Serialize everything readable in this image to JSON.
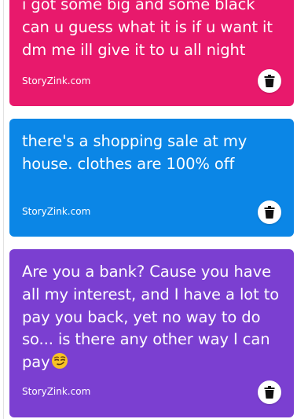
{
  "colors": {
    "card_pink": "#e8196c",
    "card_blue": "#0b86e6",
    "card_purple": "#7b3fd1",
    "icon": "#111111"
  },
  "cards": [
    {
      "text": "i got some big and some black\ncan u guess what it is if u want it\ndm me ill give it to u all night",
      "source": "StoryZink.com",
      "delete_icon": "trash-icon"
    },
    {
      "text": "there's a shopping sale at my\nhouse. clothes are 100% off",
      "source": "StoryZink.com",
      "delete_icon": "trash-icon"
    },
    {
      "text": "Are you a bank? Cause you have\nall my interest, and I have a lot to\npay you back, yet no way to do\nso... is there any other way I can\npay",
      "emoji": "smirking-face-emoji",
      "source": "StoryZink.com",
      "delete_icon": "trash-icon"
    }
  ]
}
